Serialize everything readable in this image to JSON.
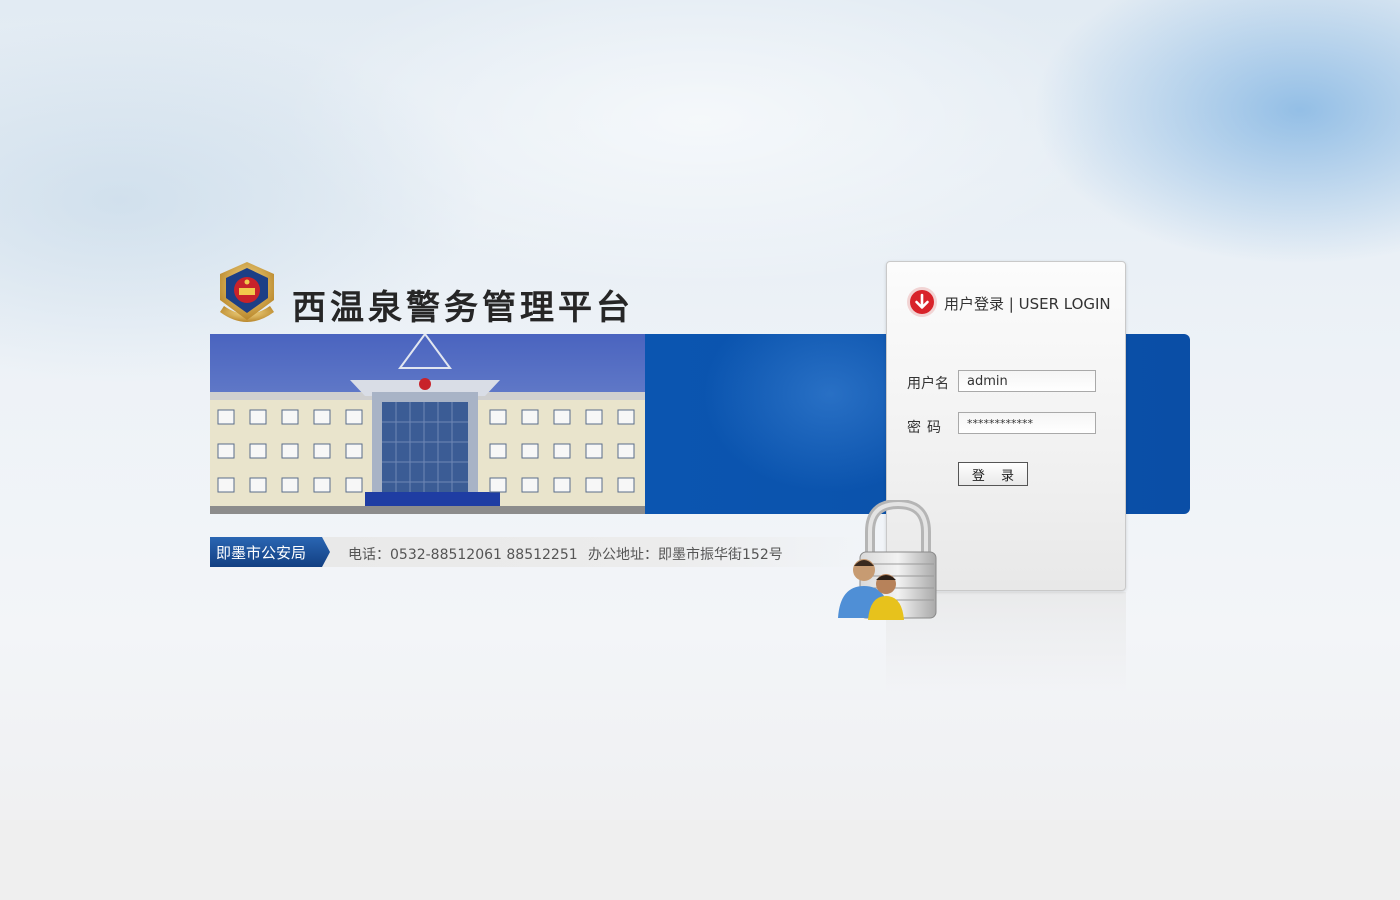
{
  "header": {
    "title": "西温泉警务管理平台"
  },
  "footer": {
    "org_name": "即墨市公安局",
    "phone": "电话：0532-88512061 88512251",
    "address": "办公地址：即墨市振华街152号"
  },
  "login": {
    "heading": "用户登录 | USER LOGIN",
    "username_label": "用户名",
    "username_value": "admin",
    "password_label": "密码",
    "password_value": "************",
    "submit_label": "登 录"
  },
  "colors": {
    "banner_blue": "#0a54ae",
    "badge_blue": "#1a4f98",
    "login_icon_red": "#d8232a"
  },
  "icons": [
    "police-emblem-icon",
    "login-arrow-icon",
    "padlock-users-icon"
  ]
}
